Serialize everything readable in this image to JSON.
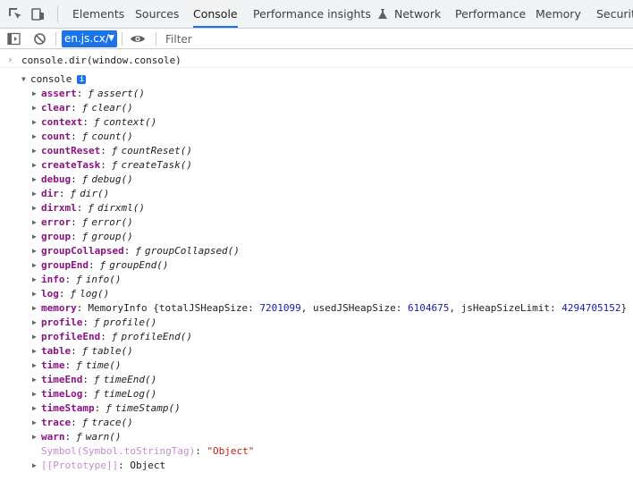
{
  "tabs": [
    {
      "label": "Elements"
    },
    {
      "label": "Sources"
    },
    {
      "label": "Console"
    },
    {
      "label": "Performance insights"
    },
    {
      "label": "Network"
    },
    {
      "label": "Performance"
    },
    {
      "label": "Memory"
    },
    {
      "label": "Security"
    }
  ],
  "toolbar": {
    "context": "en.js.cx/",
    "filter_placeholder": "Filter"
  },
  "console": {
    "prompt": "console.dir(window.console)",
    "root_label": "console",
    "info_badge": "i",
    "entries": [
      {
        "key": "assert",
        "value": "assert()"
      },
      {
        "key": "clear",
        "value": "clear()"
      },
      {
        "key": "context",
        "value": "context()"
      },
      {
        "key": "count",
        "value": "count()"
      },
      {
        "key": "countReset",
        "value": "countReset()"
      },
      {
        "key": "createTask",
        "value": "createTask()"
      },
      {
        "key": "debug",
        "value": "debug()"
      },
      {
        "key": "dir",
        "value": "dir()"
      },
      {
        "key": "dirxml",
        "value": "dirxml()"
      },
      {
        "key": "error",
        "value": "error()"
      },
      {
        "key": "group",
        "value": "group()"
      },
      {
        "key": "groupCollapsed",
        "value": "groupCollapsed()"
      },
      {
        "key": "groupEnd",
        "value": "groupEnd()"
      },
      {
        "key": "info",
        "value": "info()"
      },
      {
        "key": "log",
        "value": "log()"
      },
      {
        "key": "memory",
        "value": "MemoryInfo {totalJSHeapSize: 7201099, usedJSHeapSize: 6104675, jsHeapSizeLimit: 4294705152}"
      },
      {
        "key": "profile",
        "value": "profile()"
      },
      {
        "key": "profileEnd",
        "value": "profileEnd()"
      },
      {
        "key": "table",
        "value": "table()"
      },
      {
        "key": "time",
        "value": "time()"
      },
      {
        "key": "timeEnd",
        "value": "timeEnd()"
      },
      {
        "key": "timeLog",
        "value": "timeLog()"
      },
      {
        "key": "timeStamp",
        "value": "timeStamp()"
      },
      {
        "key": "trace",
        "value": "trace()"
      },
      {
        "key": "warn",
        "value": "warn()"
      }
    ],
    "symbol_key": "Symbol(Symbol.toStringTag)",
    "symbol_value": "\"Object\"",
    "prototype_key": "[[Prototype]]",
    "prototype_value": "Object",
    "memory_parts": {
      "prefix": "MemoryInfo {totalJSHeapSize: ",
      "total": "7201099",
      "used_label": ", usedJSHeapSize: ",
      "used": "6104675",
      "limit_label": ", jsHeapSizeLimit: ",
      "limit": "4294705152",
      "suffix": "}"
    },
    "function_marker": "ƒ"
  }
}
